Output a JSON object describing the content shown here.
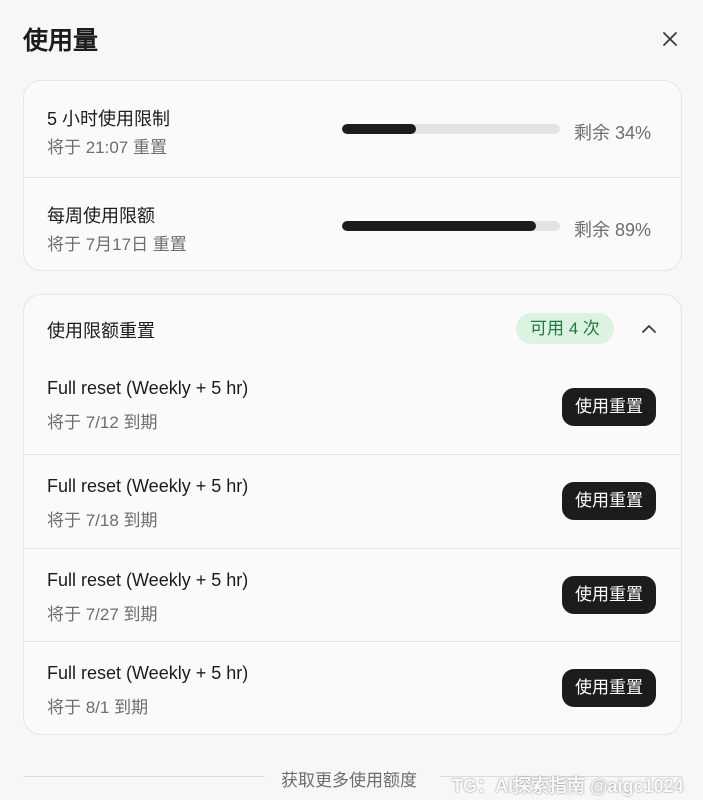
{
  "header": {
    "title": "使用量"
  },
  "limits": [
    {
      "title": "5 小时使用限制",
      "reset_text": "将于 21:07 重置",
      "remaining_text": "剩余 34%",
      "used_fraction": 0.34
    },
    {
      "title": "每周使用限额",
      "reset_text": "将于 7月17日 重置",
      "remaining_text": "剩余 89%",
      "used_fraction": 0.89
    }
  ],
  "resets": {
    "title": "使用限额重置",
    "available_badge": "可用 4 次",
    "items": [
      {
        "name": "Full reset (Weekly + 5 hr)",
        "expiry": "将于 7/12 到期",
        "button": "使用重置"
      },
      {
        "name": "Full reset (Weekly + 5 hr)",
        "expiry": "将于 7/18 到期",
        "button": "使用重置"
      },
      {
        "name": "Full reset (Weekly + 5 hr)",
        "expiry": "将于 7/27 到期",
        "button": "使用重置"
      },
      {
        "name": "Full reset (Weekly + 5 hr)",
        "expiry": "将于 8/1 到期",
        "button": "使用重置"
      }
    ]
  },
  "footer": {
    "more_link": "获取更多使用额度"
  },
  "watermark": "TG：AI探索指南 @aigc1024",
  "colors": {
    "bar_fill": "#1b1c1e",
    "bar_track": "#e3e3e3",
    "badge_bg": "#dcf3e2",
    "badge_text": "#1f7a3d"
  }
}
